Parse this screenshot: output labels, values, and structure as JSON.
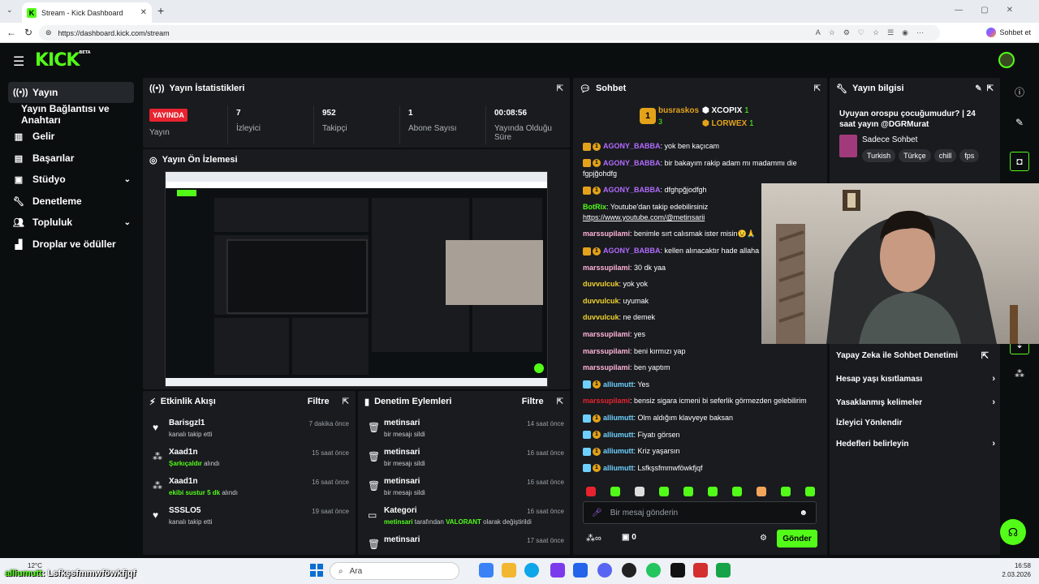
{
  "browser": {
    "tab_title": "Stream - Kick Dashboard",
    "url": "https://dashboard.kick.com/stream",
    "copilot_label": "Sohbet et"
  },
  "logo": "KICK",
  "logo_sup": "BETA",
  "sidebar": {
    "items": [
      {
        "label": "Yayın",
        "icon": "broadcast-icon"
      },
      {
        "label": "Yayın Bağlantısı ve Anahtarı",
        "icon": ""
      },
      {
        "label": "Gelir",
        "icon": "chart-icon"
      },
      {
        "label": "Başarılar",
        "icon": "trophy-icon"
      },
      {
        "label": "Stüdyo",
        "icon": "studio-icon"
      },
      {
        "label": "Denetleme",
        "icon": "wrench-icon"
      },
      {
        "label": "Topluluk",
        "icon": "people-icon"
      },
      {
        "label": "Droplar ve ödüller",
        "icon": "gift-icon"
      }
    ]
  },
  "stats": {
    "title": "Yayın İstatistikleri",
    "live_badge": "YAYINDA",
    "items": [
      {
        "value": "",
        "label": "Yayın"
      },
      {
        "value": "7",
        "label": "İzleyici"
      },
      {
        "value": "952",
        "label": "Takipçi"
      },
      {
        "value": "1",
        "label": "Abone Sayısı"
      },
      {
        "value": "00:08:56",
        "label": "Yayında Olduğu Süre"
      }
    ]
  },
  "preview": {
    "title": "Yayın Ön İzlemesi"
  },
  "activity": {
    "title": "Etkinlik Akışı",
    "filter": "Filtre",
    "items": [
      {
        "name": "Barisgzl1",
        "sub": "kanalı takip etti",
        "highlight": "",
        "sub2": "",
        "time": "7 dakika önce",
        "icon": "heart-icon"
      },
      {
        "name": "Xaad1n",
        "sub": "",
        "highlight": "Şarkıçaldır",
        "sub2": " alındı",
        "time": "15 saat önce",
        "icon": "reward-icon"
      },
      {
        "name": "Xaad1n",
        "sub": "",
        "highlight": "ekibi sustur 5 dk",
        "sub2": " alındı",
        "time": "16 saat önce",
        "icon": "reward-icon"
      },
      {
        "name": "SSSLO5",
        "sub": "kanalı takip etti",
        "highlight": "",
        "sub2": "",
        "time": "19 saat önce",
        "icon": "heart-icon"
      }
    ]
  },
  "moderation": {
    "title": "Denetim Eylemleri",
    "filter": "Filtre",
    "items": [
      {
        "name": "metinsari",
        "sub": "bir mesajı sildi",
        "time": "14 saat önce",
        "icon": "trash-icon"
      },
      {
        "name": "metinsari",
        "sub": "bir mesajı sildi",
        "time": "16 saat önce",
        "icon": "trash-icon"
      },
      {
        "name": "metinsari",
        "sub": "bir mesajı sildi",
        "time": "16 saat önce",
        "icon": "trash-icon"
      },
      {
        "name": "Kategori",
        "sub_user": "metinsari",
        "sub_mid": " tarafından ",
        "sub_hl": "VALORANT",
        "sub_end": " olarak değiştirildi",
        "time": "16 saat önce",
        "icon": "category-icon"
      },
      {
        "name": "metinsari",
        "sub": "bir mesajı sildi",
        "time": "17 saat önce",
        "icon": "trash-icon"
      }
    ]
  },
  "chat": {
    "title": "Sohbet",
    "leaders": [
      {
        "name": "busraskos",
        "count": "3",
        "color": "#e3a21a"
      },
      {
        "name": "XCOPIX",
        "count": "1",
        "color": "#ffffff"
      },
      {
        "name": "LORWEX",
        "count": "1",
        "color": "#e3a21a"
      }
    ],
    "messages": [
      {
        "user": "AGONY_BABBA",
        "text": ": yok ben kaçıcam",
        "color": "#b36bff",
        "badge": true
      },
      {
        "user": "AGONY_BABBA",
        "text": ": bir bakayım rakip adam mı madammı die",
        "text2": "fgpjğohdfg",
        "color": "#b36bff",
        "badge": true
      },
      {
        "user": "AGONY_BABBA",
        "text": ": dfghpğjodfgh",
        "color": "#b36bff",
        "badge": true
      },
      {
        "user": "BotRix",
        "text": ": Youtube'dan takip edebilirsiniz",
        "text2": "https://www.youtube.com/@metinsarii",
        "color": "#53fc18",
        "badge": false
      },
      {
        "user": "marssupilami",
        "text": ": benimle sırt calısmak ister misin😉🙏",
        "color": "#ffb3d9",
        "badge": false
      },
      {
        "user": "AGONY_BABBA",
        "text": ": kellen alınacaktır hade allaha",
        "color": "#b36bff",
        "badge": true
      },
      {
        "user": "marssupilami",
        "text": ": 30 dk yaa",
        "color": "#ffb3d9",
        "badge": false
      },
      {
        "user": "duvvulcuk",
        "text": ": yok yok",
        "color": "#f2d22e",
        "badge": false
      },
      {
        "user": "duvvulcuk",
        "text": ": uyumak",
        "color": "#f2d22e",
        "badge": false
      },
      {
        "user": "duvvulcuk",
        "text": ": ne demek",
        "color": "#f2d22e",
        "badge": false
      },
      {
        "user": "marssupilami",
        "text": ": yes",
        "color": "#ffb3d9",
        "badge": false
      },
      {
        "user": "marssupilami",
        "text": ": beni kırmızı yap",
        "color": "#ffb3d9",
        "badge": false
      },
      {
        "user": "marssupilami",
        "text": ": ben yaptım",
        "color": "#ffb3d9",
        "badge": false
      },
      {
        "user": "alliumutt",
        "text": ": Yes",
        "color": "#6fd0ff",
        "badge": true
      },
      {
        "user": "marssupilami",
        "text": ": bensiz sigara icmeni bi seferlik görmezden gelebilirim",
        "color": "#e8232f",
        "badge": false
      },
      {
        "user": "alliumutt",
        "text": ": Olm aldığım klavyeye baksan",
        "color": "#6fd0ff",
        "badge": true
      },
      {
        "user": "alliumutt",
        "text": ": Fiyatı görsen",
        "color": "#6fd0ff",
        "badge": true
      },
      {
        "user": "alliumutt",
        "text": ": Kriz yaşarsın",
        "color": "#6fd0ff",
        "badge": true
      },
      {
        "user": "alliumutt",
        "text": ": Lsfkşsfmmwföwkfjqf",
        "color": "#6fd0ff",
        "badge": true
      }
    ],
    "input_placeholder": "Bir mesaj gönderin",
    "points": "0",
    "send": "Gönder"
  },
  "info": {
    "title": "Yayın bilgisi",
    "stream_title": "Uyuyan orospu çocuğumudur? | 24 saat yayın @DGRMurat",
    "category": "Sadece Sohbet",
    "tags": [
      "Turkish",
      "Türkçe",
      "chill",
      "fps"
    ],
    "links": [
      {
        "label": "Yapay Zeka ile Sohbet Denetimi",
        "icon": "external-icon"
      },
      {
        "label": "Hesap yaşı kısıtlaması",
        "icon": "chevron-right-icon"
      },
      {
        "label": "Yasaklanmış kelimeler",
        "icon": "chevron-right-icon"
      },
      {
        "label": "İzleyici Yönlendir",
        "icon": ""
      },
      {
        "label": "Hedefleri belirleyin",
        "icon": "chevron-right-icon"
      }
    ]
  },
  "taskbar": {
    "weather": "12°C",
    "search": "Ara",
    "time": "16:58",
    "date": "2.03.2026"
  },
  "overlay": {
    "user": "alliumutt",
    "text": ": Lsfkşsfmmwföwkfjqf"
  }
}
